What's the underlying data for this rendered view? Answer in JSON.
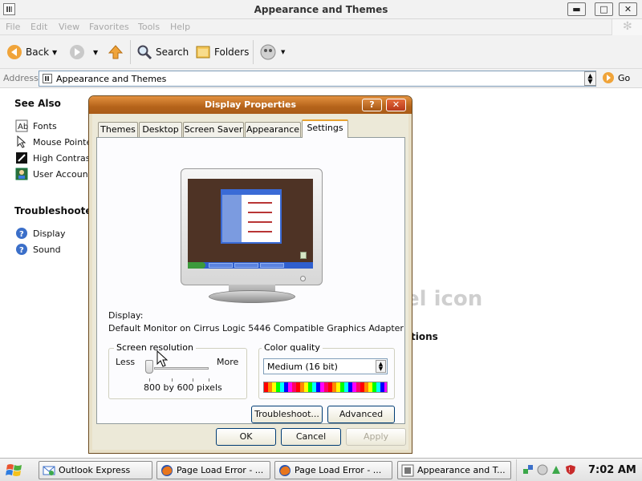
{
  "explorer": {
    "title": "Appearance and Themes",
    "window_controls": {
      "minimize": "▬",
      "maximize": "□",
      "close": "✕"
    },
    "menu": [
      "File",
      "Edit",
      "View",
      "Favorites",
      "Tools",
      "Help"
    ],
    "toolbar": {
      "back": "Back",
      "search": "Search",
      "folders": "Folders"
    },
    "address": {
      "label": "Address",
      "value": "Appearance and Themes",
      "go": "Go"
    },
    "see_also": {
      "title": "See Also",
      "items": [
        "Fonts",
        "Mouse Pointer",
        "High Contrast",
        "User Account"
      ]
    },
    "troubleshooters": {
      "title": "Troubleshooters",
      "items": [
        "Display",
        "Sound"
      ]
    },
    "background_fragments": {
      "large": "el icon",
      "small": "tions"
    }
  },
  "dialog": {
    "title": "Display Properties",
    "help_btn": "?",
    "close_btn": "✕",
    "tabs": [
      "Themes",
      "Desktop",
      "Screen Saver",
      "Appearance",
      "Settings"
    ],
    "active_tab": "Settings",
    "display_label": "Display:",
    "display_value": "Default Monitor on Cirrus Logic 5446 Compatible Graphics Adapter",
    "resolution": {
      "group_label": "Screen resolution",
      "less": "Less",
      "more": "More",
      "value": "800 by 600 pixels",
      "slider_level": 0
    },
    "color_quality": {
      "group_label": "Color quality",
      "selected": "Medium (16 bit)"
    },
    "buttons": {
      "troubleshoot": "Troubleshoot...",
      "advanced": "Advanced",
      "ok": "OK",
      "cancel": "Cancel",
      "apply": "Apply"
    }
  },
  "taskbar": {
    "items": [
      "Outlook Express",
      "Page Load Error - ...",
      "Page Load Error - ...",
      "Appearance and T..."
    ],
    "clock": "7:02 AM"
  },
  "colors": {
    "dialog_title": "#c1721f",
    "tab_accent": "#e8a22d",
    "desktop_preview": "#4e3325"
  }
}
